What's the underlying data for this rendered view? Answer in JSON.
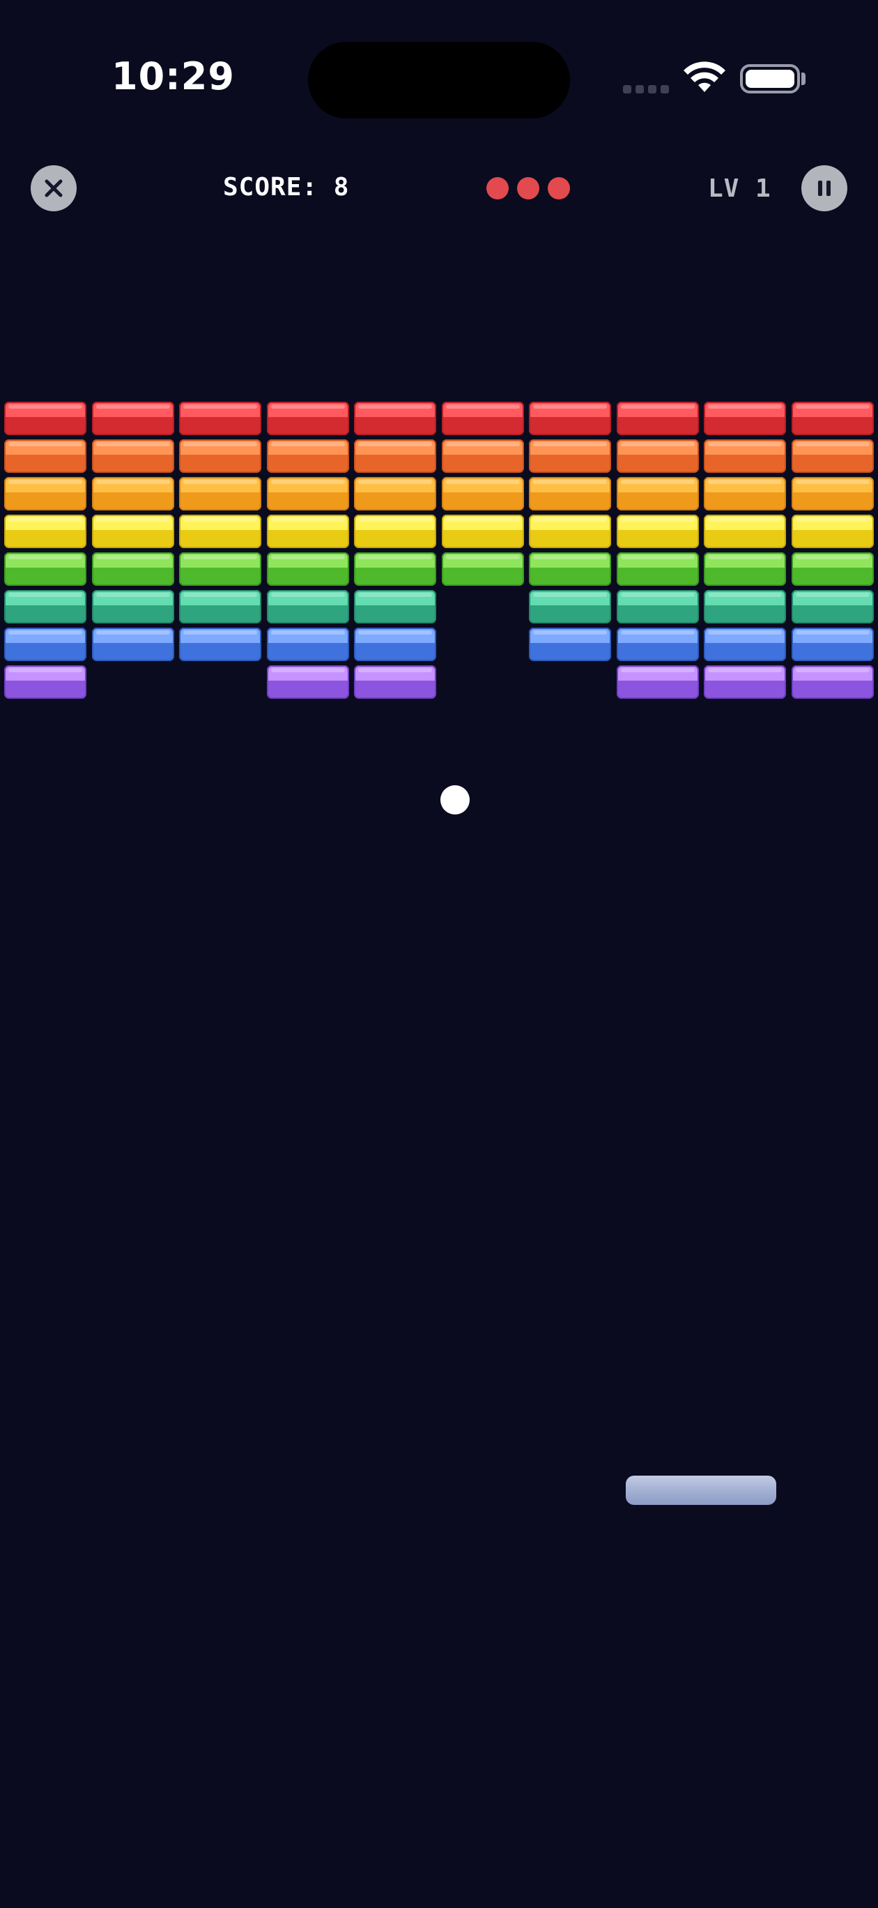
{
  "status_bar": {
    "time": "10:29",
    "battery_level": 1.0
  },
  "hud": {
    "close_icon": "close-icon",
    "score_text": "SCORE: 8",
    "lives": 3,
    "life_color": "#e24a4f",
    "level_text": "LV 1",
    "pause_icon": "pause-icon"
  },
  "board": {
    "columns": 10,
    "rows": [
      {
        "color": "red",
        "top": "#ff5a5f",
        "bottom": "#d42b31",
        "rim": "#b81e24",
        "present": [
          1,
          1,
          1,
          1,
          1,
          1,
          1,
          1,
          1,
          1
        ]
      },
      {
        "color": "orange",
        "top": "#ff9554",
        "bottom": "#e8652a",
        "rim": "#c9511c",
        "present": [
          1,
          1,
          1,
          1,
          1,
          1,
          1,
          1,
          1,
          1
        ]
      },
      {
        "color": "amber",
        "top": "#ffbf45",
        "bottom": "#f09a1c",
        "rim": "#d38112",
        "present": [
          1,
          1,
          1,
          1,
          1,
          1,
          1,
          1,
          1,
          1
        ]
      },
      {
        "color": "yellow",
        "top": "#fff35a",
        "bottom": "#e9cb14",
        "rim": "#c7a80e",
        "present": [
          1,
          1,
          1,
          1,
          1,
          1,
          1,
          1,
          1,
          1
        ]
      },
      {
        "color": "green",
        "top": "#8fe55c",
        "bottom": "#4fb92c",
        "rim": "#3c9a21",
        "present": [
          1,
          1,
          1,
          1,
          1,
          1,
          1,
          1,
          1,
          1
        ]
      },
      {
        "color": "teal",
        "top": "#62dcb0",
        "bottom": "#2fa57f",
        "rim": "#23896a",
        "present": [
          1,
          1,
          1,
          1,
          1,
          0,
          1,
          1,
          1,
          1
        ]
      },
      {
        "color": "blue",
        "top": "#7eaaff",
        "bottom": "#3f72dc",
        "rim": "#2d5cbf",
        "present": [
          1,
          1,
          1,
          1,
          1,
          0,
          1,
          1,
          1,
          1
        ]
      },
      {
        "color": "purple",
        "top": "#c592ff",
        "bottom": "#8c55e0",
        "rim": "#7140c4",
        "present": [
          1,
          0,
          0,
          1,
          1,
          0,
          0,
          1,
          1,
          1
        ]
      }
    ]
  },
  "ball": {
    "color": "#ffffff"
  },
  "paddle": {
    "color": "#a9b6d6"
  }
}
